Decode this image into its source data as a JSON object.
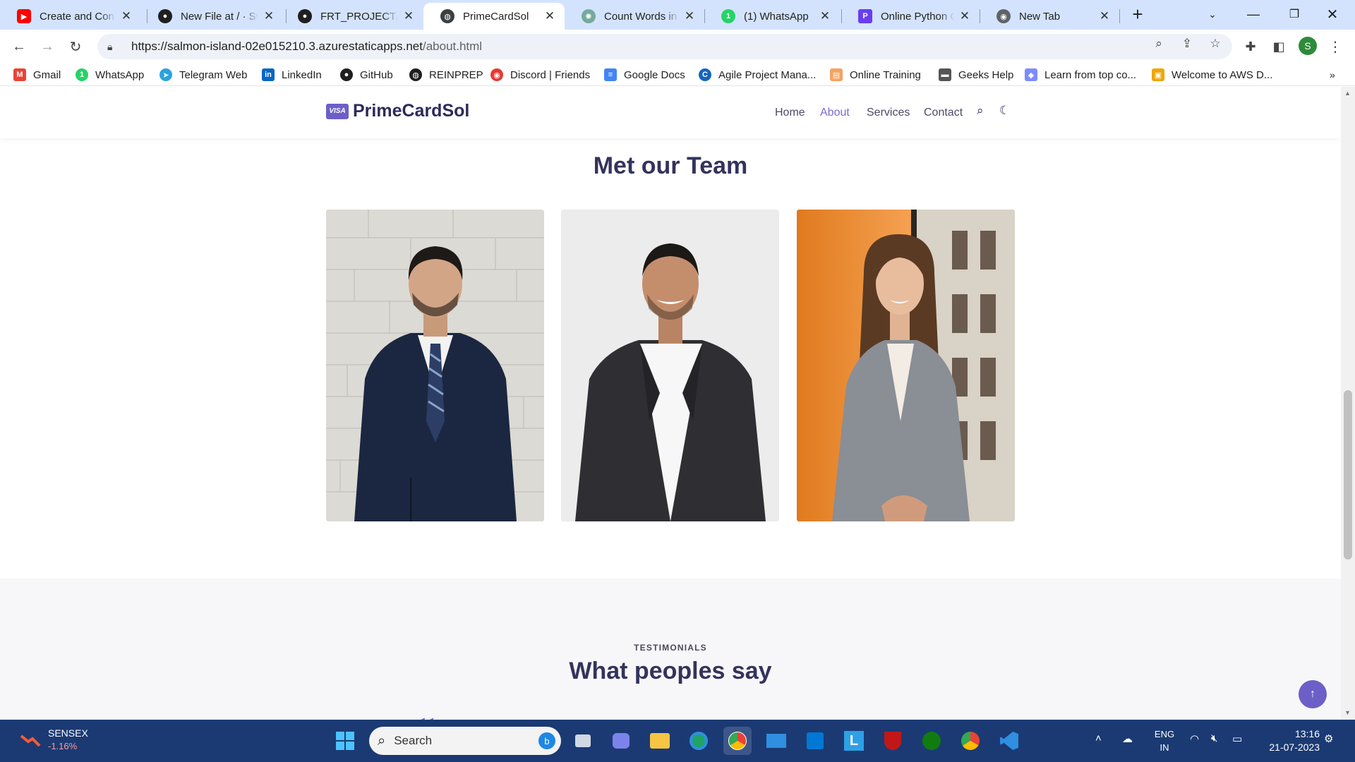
{
  "browser": {
    "tabs": [
      {
        "title": "Create and Config",
        "icon": "youtube-icon",
        "color": "#ff0000"
      },
      {
        "title": "New File at / · Sw",
        "icon": "github-icon",
        "color": "#1f1f1f"
      },
      {
        "title": "FRT_PROJECT/ass",
        "icon": "github-icon",
        "color": "#1f1f1f"
      },
      {
        "title": "PrimeCardSol",
        "icon": "globe-icon",
        "color": "#3c4043"
      },
      {
        "title": "Count Words in S",
        "icon": "chatgpt-icon",
        "color": "#74aa9c"
      },
      {
        "title": "(1) WhatsApp",
        "icon": "whatsapp-icon",
        "color": "#25d366"
      },
      {
        "title": "Online Python Co",
        "icon": "python-ide-icon",
        "color": "#6a3df0"
      },
      {
        "title": "New Tab",
        "icon": "chrome-icon",
        "color": "#5f6368"
      }
    ],
    "active_tab_index": 3,
    "address": {
      "host": "https://salmon-island-02e015210.3.azurestaticapps.net",
      "path": "/about.html"
    },
    "profile_initial": "S",
    "bookmarks": [
      {
        "label": "Gmail",
        "icon": "gmail-icon",
        "color": "#ea4335"
      },
      {
        "label": "WhatsApp",
        "icon": "whatsapp-icon",
        "color": "#25d366"
      },
      {
        "label": "Telegram Web",
        "icon": "telegram-icon",
        "color": "#2aa3df"
      },
      {
        "label": "LinkedIn",
        "icon": "linkedin-icon",
        "color": "#0a66c2"
      },
      {
        "label": "GitHub",
        "icon": "github-icon",
        "color": "#1f1f1f"
      },
      {
        "label": "REINPREP",
        "icon": "globe-icon",
        "color": "#1f1f1f"
      },
      {
        "label": "Discord | Friends",
        "icon": "discord-icon",
        "color": "#e53935"
      },
      {
        "label": "Google Docs",
        "icon": "google-docs-icon",
        "color": "#4285f4"
      },
      {
        "label": "Agile Project Mana...",
        "icon": "agile-icon",
        "color": "#1565c0"
      },
      {
        "label": "Online Training",
        "icon": "training-icon",
        "color": "#f4a261"
      },
      {
        "label": "Geeks Help",
        "icon": "geeks-icon",
        "color": "#555555"
      },
      {
        "label": "Learn from top co...",
        "icon": "learn-icon",
        "color": "#7b8cff"
      },
      {
        "label": "Welcome to AWS D...",
        "icon": "aws-icon",
        "color": "#f0a500"
      }
    ]
  },
  "site": {
    "brand": "PrimeCardSol",
    "brand_badge": "VISA",
    "nav": [
      "Home",
      "About",
      "Services",
      "Contact"
    ],
    "active_nav": "About",
    "team_heading": "Met our Team",
    "team_photos": [
      "man-navy-suit-photo",
      "man-dark-blazer-photo",
      "woman-grey-blazer-photo"
    ],
    "testimonials_eyebrow": "TESTIMONIALS",
    "testimonials_heading": "What peoples say",
    "quote_glyph": "“",
    "accent": "#6c5fc7",
    "heading_color": "#33335c"
  },
  "taskbar": {
    "widget_label": "SENSEX",
    "widget_change": "-1.16%",
    "search_placeholder": "Search",
    "lang_top": "ENG",
    "lang_bottom": "IN",
    "time": "13:16",
    "date": "21-07-2023"
  }
}
